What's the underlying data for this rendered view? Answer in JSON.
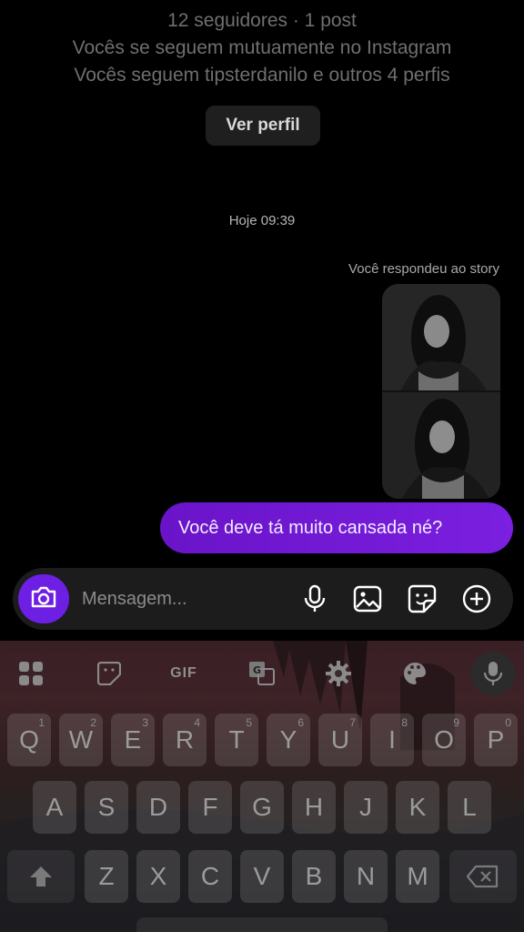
{
  "profile": {
    "followers_line": "12 seguidores · 1 post",
    "mutual_line": "Vocês se seguem mutuamente no Instagram",
    "following_line": "Vocês seguem tipsterdanilo e outros 4 perfis",
    "view_profile_label": "Ver perfil"
  },
  "chat": {
    "timestamp": "Hoje 09:39",
    "story_reply_label": "Você respondeu ao story",
    "message": "Você deve tá muito cansada né?"
  },
  "composer": {
    "placeholder": "Mensagem...",
    "icons": [
      "camera-icon",
      "microphone-icon",
      "gallery-icon",
      "sticker-icon",
      "plus-icon"
    ],
    "camera_color": "#6d1fe4"
  },
  "keyboard": {
    "toolbar": {
      "gif_label": "GIF",
      "icons": [
        "apps-grid-icon",
        "sticker-icon",
        "translate-icon",
        "settings-gear-icon",
        "palette-icon",
        "microphone-icon"
      ]
    },
    "row1": [
      {
        "key": "Q",
        "hint": "1"
      },
      {
        "key": "W",
        "hint": "2"
      },
      {
        "key": "E",
        "hint": "3"
      },
      {
        "key": "R",
        "hint": "4"
      },
      {
        "key": "T",
        "hint": "5"
      },
      {
        "key": "Y",
        "hint": "6"
      },
      {
        "key": "U",
        "hint": "7"
      },
      {
        "key": "I",
        "hint": "8"
      },
      {
        "key": "O",
        "hint": "9"
      },
      {
        "key": "P",
        "hint": "0"
      }
    ],
    "row2": [
      "A",
      "S",
      "D",
      "F",
      "G",
      "H",
      "J",
      "K",
      "L"
    ],
    "row3": [
      "Z",
      "X",
      "C",
      "V",
      "B",
      "N",
      "M"
    ]
  },
  "colors": {
    "bubble": "#7b1fe0",
    "background": "#000000"
  }
}
